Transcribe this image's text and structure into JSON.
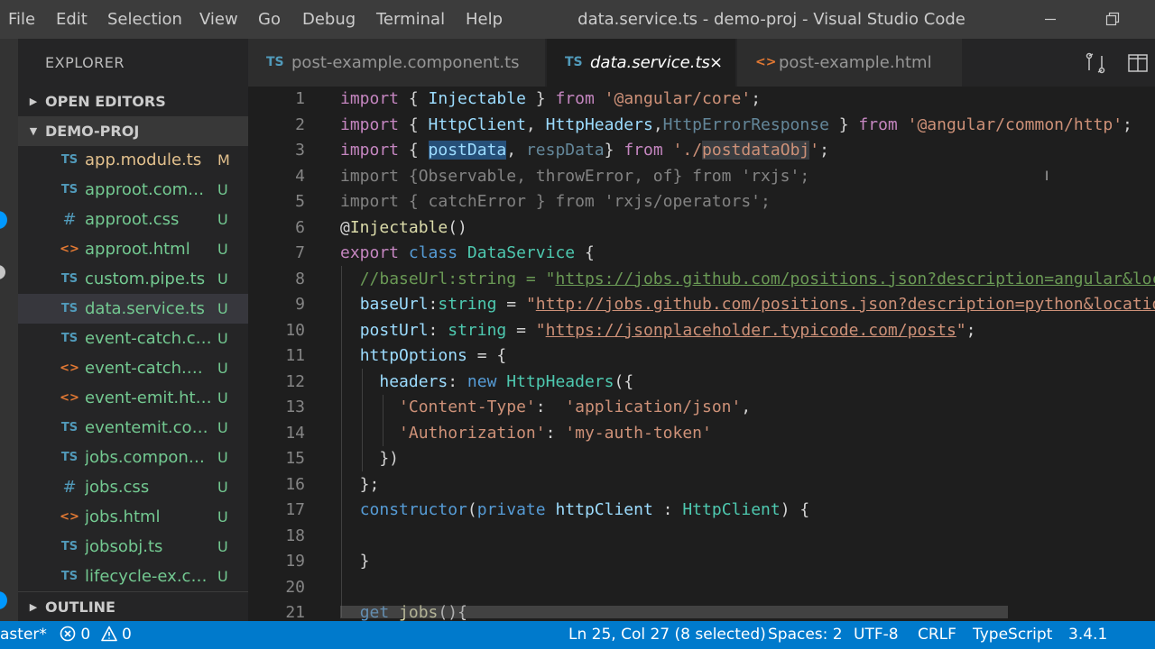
{
  "window": {
    "title": "data.service.ts - demo-proj - Visual Studio Code"
  },
  "menu": [
    "File",
    "Edit",
    "Selection",
    "View",
    "Go",
    "Debug",
    "Terminal",
    "Help"
  ],
  "sidebar": {
    "title": "EXPLORER",
    "open_editors": "OPEN EDITORS",
    "project": "DEMO-PROJ",
    "outline": "OUTLINE",
    "files": [
      {
        "icon": "TS",
        "name": "app.module.ts",
        "status": "M"
      },
      {
        "icon": "TS",
        "name": "approot.comp...",
        "status": "U"
      },
      {
        "icon": "#",
        "name": "approot.css",
        "status": "U"
      },
      {
        "icon": "<>",
        "name": "approot.html",
        "status": "U"
      },
      {
        "icon": "TS",
        "name": "custom.pipe.ts",
        "status": "U"
      },
      {
        "icon": "TS",
        "name": "data.service.ts",
        "status": "U"
      },
      {
        "icon": "TS",
        "name": "event-catch.co...",
        "status": "U"
      },
      {
        "icon": "<>",
        "name": "event-catch.ht...",
        "status": "U"
      },
      {
        "icon": "<>",
        "name": "event-emit.html",
        "status": "U"
      },
      {
        "icon": "TS",
        "name": "eventemit.com...",
        "status": "U"
      },
      {
        "icon": "TS",
        "name": "jobs.compone...",
        "status": "U"
      },
      {
        "icon": "#",
        "name": "jobs.css",
        "status": "U"
      },
      {
        "icon": "<>",
        "name": "jobs.html",
        "status": "U"
      },
      {
        "icon": "TS",
        "name": "jobsobj.ts",
        "status": "U"
      },
      {
        "icon": "TS",
        "name": "lifecycle-ex.co...",
        "status": "U"
      }
    ]
  },
  "tabs": [
    {
      "icon": "TS",
      "label": "post-example.component.ts",
      "active": false
    },
    {
      "icon": "TS",
      "label": "data.service.ts",
      "active": true,
      "close": "×"
    },
    {
      "icon": "<>",
      "label": "post-example.html",
      "active": false
    }
  ],
  "editor": {
    "line_numbers": [
      "1",
      "2",
      "3",
      "4",
      "5",
      "6",
      "7",
      "8",
      "9",
      "10",
      "11",
      "12",
      "13",
      "14",
      "15",
      "16",
      "17",
      "18",
      "19",
      "20",
      "21"
    ]
  },
  "status": {
    "branch": "aster*",
    "errors": "0",
    "warnings": "0",
    "position": "Ln 25, Col 27 (8 selected)",
    "spaces": "Spaces: 2",
    "encoding": "UTF-8",
    "eol": "CRLF",
    "language": "TypeScript",
    "version": "3.4.1"
  },
  "colors": {
    "accent": "#007acc",
    "untracked": "#73c991",
    "modified": "#e2c08d",
    "ts_icon": "#519aba",
    "html_icon": "#e37933",
    "css_icon": "#519aba"
  }
}
